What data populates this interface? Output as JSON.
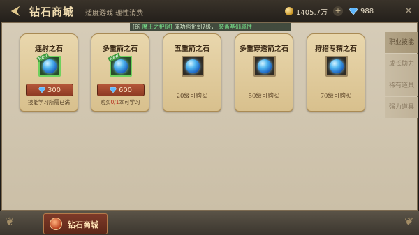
{
  "header": {
    "back_glyph": "⮜",
    "title": "钻石商城",
    "age_notice": "适度游戏 理性消费",
    "gold": "1405.7万",
    "diamonds": "988",
    "plus": "+",
    "close": "✕"
  },
  "ticker": {
    "prefix": "[的",
    "highlight": "魔王之护腿]",
    "rest": "成功强化到7级，",
    "highlight2": "装备基础属性"
  },
  "side_tabs": [
    {
      "label": "职业技能"
    },
    {
      "label": "成长助力"
    },
    {
      "label": "稀有道具"
    },
    {
      "label": "强力道具"
    }
  ],
  "cards": [
    {
      "name": "连射之石",
      "price": "300",
      "note": "技能学习所需已满",
      "state": "buy"
    },
    {
      "name": "多重箭之石",
      "price": "600",
      "note_prefix": "购买",
      "note_count": "0/1",
      "note_suffix": "本可学习",
      "state": "buy"
    },
    {
      "name": "五重箭之石",
      "lock": "20级可购买",
      "state": "locked"
    },
    {
      "name": "多重穿透箭之石",
      "lock": "50级可购买",
      "state": "locked"
    },
    {
      "name": "狩猎专精之石",
      "lock": "70级可购买",
      "state": "locked"
    }
  ],
  "new_badge": "New",
  "bottom": {
    "tab_label": "钻石商城"
  },
  "icons": {
    "gold": "gold-coin-icon",
    "diamond": "diamond-icon",
    "orb": "skill-stone-orb-icon"
  }
}
